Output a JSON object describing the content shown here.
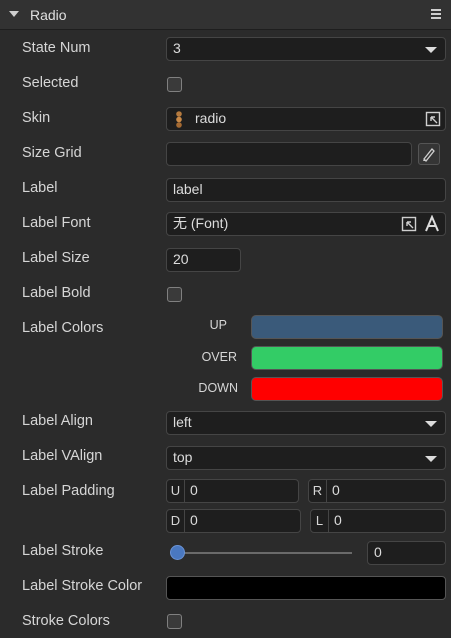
{
  "header": {
    "title": "Radio"
  },
  "rows": {
    "state_num": {
      "label": "State Num",
      "value": "3"
    },
    "selected": {
      "label": "Selected"
    },
    "skin": {
      "label": "Skin",
      "value": "radio"
    },
    "size_grid": {
      "label": "Size Grid",
      "value": ""
    },
    "label": {
      "label": "Label",
      "value": "label"
    },
    "label_font": {
      "label": "Label Font",
      "value": "无 (Font)"
    },
    "label_size": {
      "label": "Label Size",
      "value": "20"
    },
    "label_bold": {
      "label": "Label Bold"
    },
    "label_colors": {
      "label": "Label Colors",
      "states": [
        {
          "name": "UP",
          "color": "#3a5a7a"
        },
        {
          "name": "OVER",
          "color": "#33cc66"
        },
        {
          "name": "DOWN",
          "color": "#ff0000"
        }
      ]
    },
    "label_align": {
      "label": "Label Align",
      "value": "left"
    },
    "label_valign": {
      "label": "Label VAlign",
      "value": "top"
    },
    "label_padding": {
      "label": "Label Padding",
      "u": {
        "key": "U",
        "value": "0"
      },
      "r": {
        "key": "R",
        "value": "0"
      },
      "d": {
        "key": "D",
        "value": "0"
      },
      "l": {
        "key": "L",
        "value": "0"
      }
    },
    "label_stroke": {
      "label": "Label Stroke",
      "value": "0",
      "slider_fraction": 0
    },
    "label_stroke_color": {
      "label": "Label Stroke Color",
      "color": "#000000"
    },
    "stroke_colors": {
      "label": "Stroke Colors"
    }
  }
}
